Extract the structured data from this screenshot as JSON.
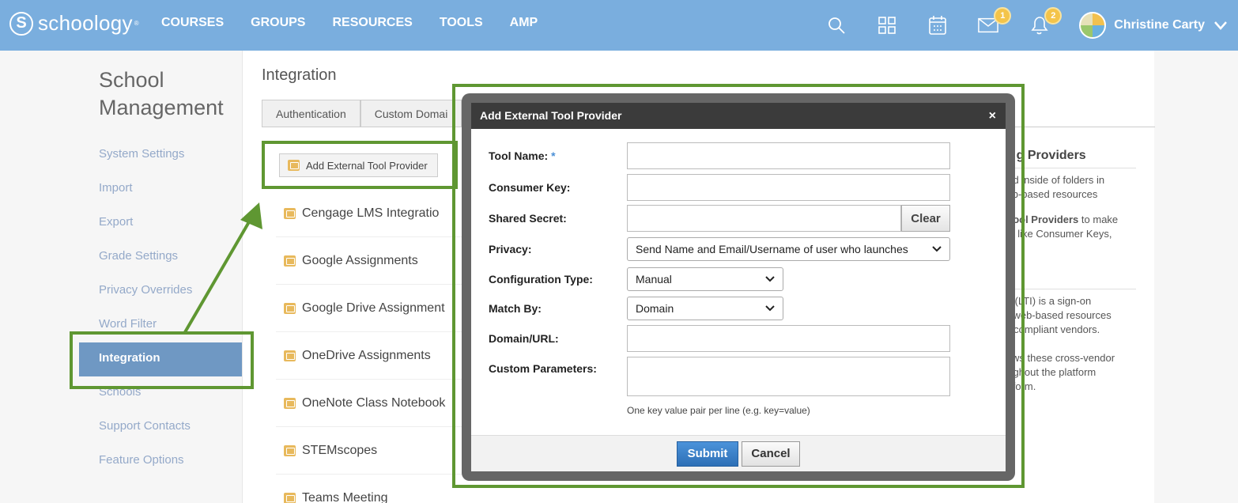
{
  "app": {
    "logo_text": "schoology",
    "logo_mark": "S",
    "logo_tm": "®"
  },
  "nav": {
    "links": [
      "COURSES",
      "GROUPS",
      "RESOURCES",
      "TOOLS",
      "AMP"
    ]
  },
  "header": {
    "messages_count": "1",
    "notifications_count": "2",
    "user_name": "Christine Carty",
    "user_chevron": "❯"
  },
  "sidebar": {
    "title_line1": "School",
    "title_line2": "Management",
    "items": [
      {
        "label": "System Settings"
      },
      {
        "label": "Import"
      },
      {
        "label": "Export"
      },
      {
        "label": "Grade Settings"
      },
      {
        "label": "Privacy Overrides"
      },
      {
        "label": "Word Filter"
      },
      {
        "label": "Integration"
      },
      {
        "label": "Schools"
      },
      {
        "label": "Support Contacts"
      },
      {
        "label": "Feature Options"
      }
    ],
    "active_index": 6
  },
  "main": {
    "title": "Integration",
    "tabs": [
      "Authentication",
      "Custom Domai",
      ""
    ],
    "add_button_label": "Add External Tool Provider",
    "providers": [
      "Cengage LMS Integratio",
      "Google Assignments",
      "Google Drive Assignment",
      "OneDrive Assignments",
      "OneNote Class Notebook",
      "STEMscopes",
      "Teams Meeting"
    ],
    "right_panel": {
      "heading": "di g Providers",
      "text1": "ded inside of folders in",
      "text2": "veb-based resources",
      "text3_bold": "l Tool Providers",
      "text3": "to make",
      "text4": "als like Consumer Keys,",
      "text5": "ity (LTI) is a sign-on",
      "text6": "to web-based resources",
      "text7": "TI compliant vendors.",
      "text8": "llows these cross-vendor",
      "text9": "oughout the platform",
      "text10": "latform."
    }
  },
  "modal": {
    "title": "Add External Tool Provider",
    "close": "×",
    "fields": {
      "tool_name_label": "Tool Name:",
      "tool_name_required": "*",
      "consumer_key_label": "Consumer Key:",
      "shared_secret_label": "Shared Secret:",
      "clear_label": "Clear",
      "privacy_label": "Privacy:",
      "privacy_value": "Send Name and Email/Username of user who launches",
      "config_type_label": "Configuration Type:",
      "config_type_value": "Manual",
      "match_by_label": "Match By:",
      "match_by_value": "Domain",
      "domain_label": "Domain/URL:",
      "custom_params_label": "Custom Parameters:",
      "custom_params_hint": "One key value pair per line (e.g. key=value)"
    },
    "submit_label": "Submit",
    "cancel_label": "Cancel"
  },
  "colors": {
    "topnav": "#7aaede",
    "annotation": "#5f9732",
    "active_sidebar": "#6f98c3",
    "submit": "#2d6fb6"
  }
}
